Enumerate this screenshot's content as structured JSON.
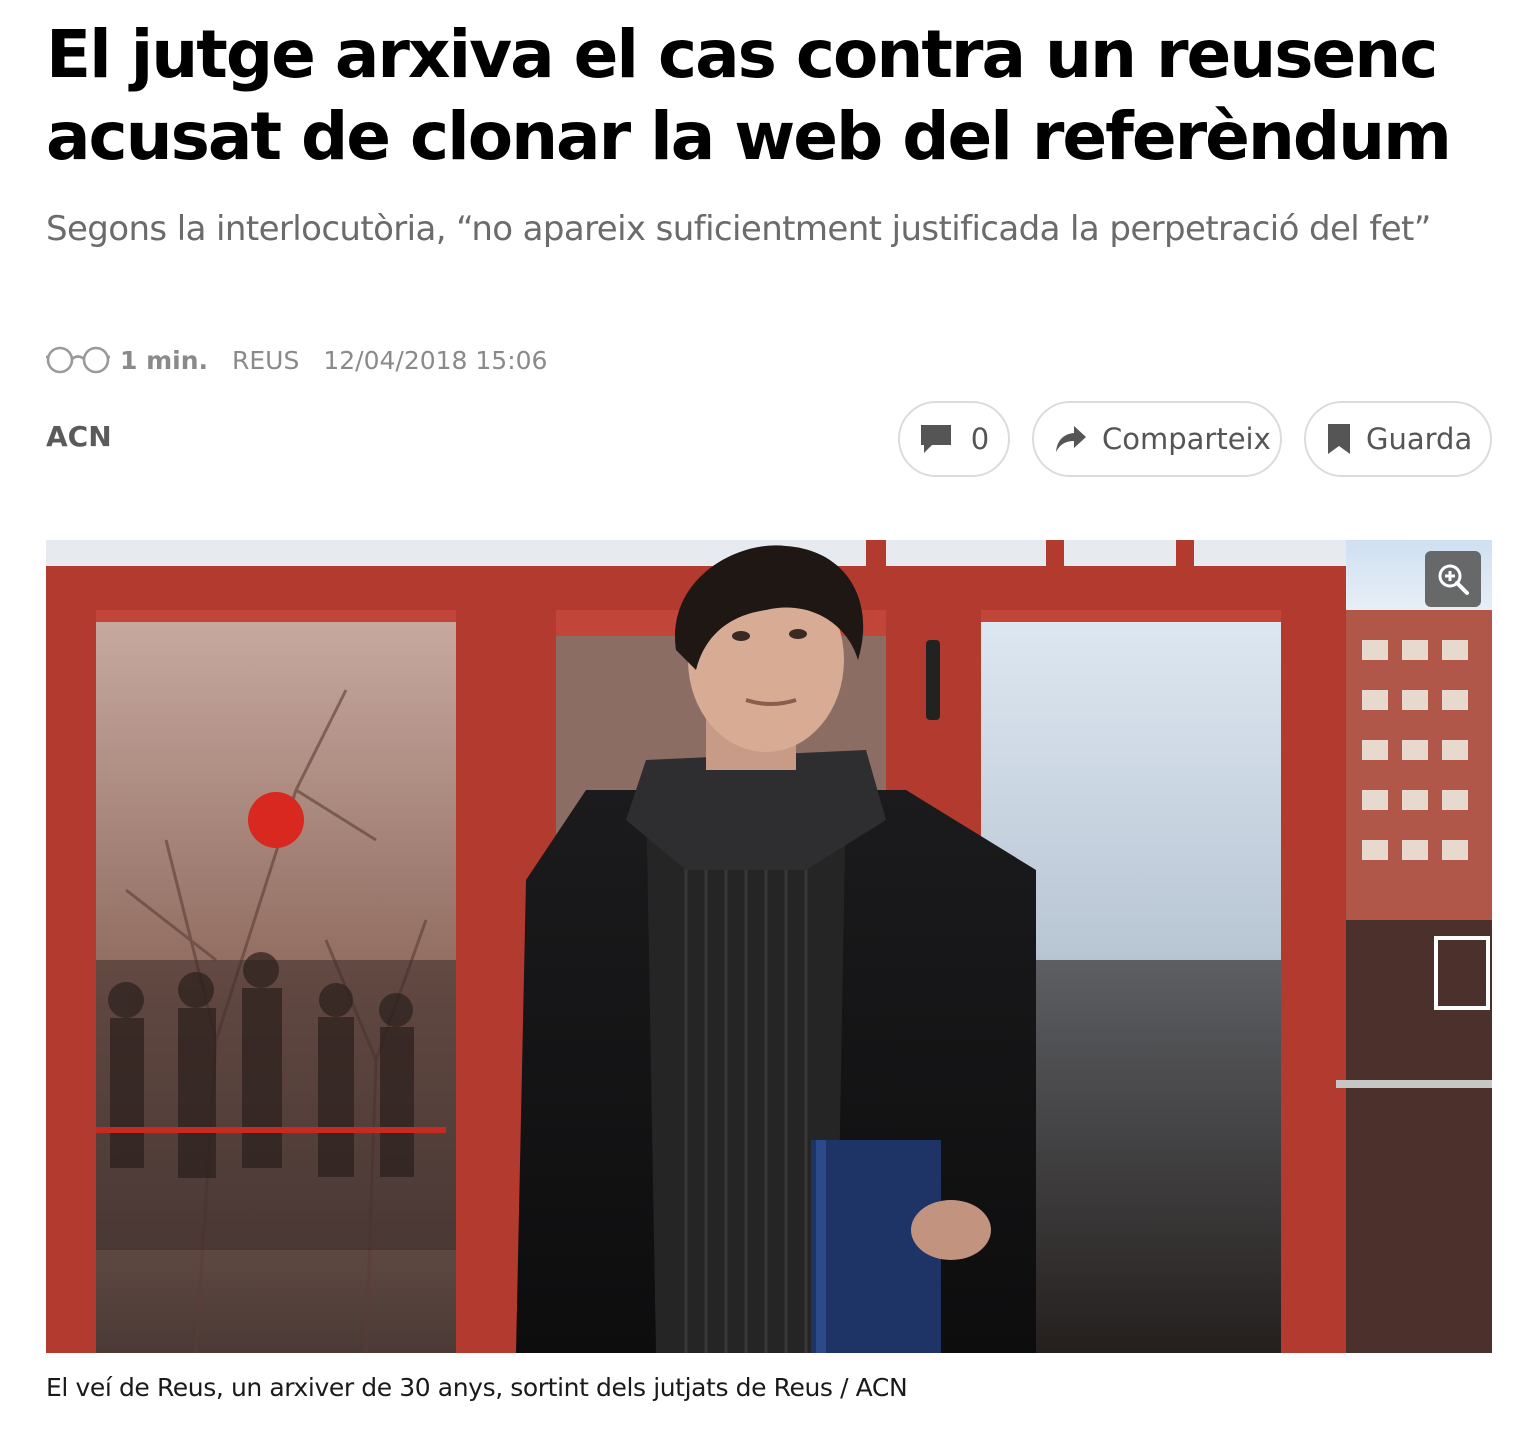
{
  "article": {
    "headline": "El jutge arxiva el cas contra un reusenc acusat de clonar la web del referèndum",
    "subtitle": "Segons la interlocutòria, “no apareix suficientment justificada la perpetració del fet”",
    "meta": {
      "read_time": "1 min.",
      "location": "REUS",
      "date": "12/04/2018 15:06",
      "icon": "glasses-icon"
    },
    "byline": "ACN",
    "actions": {
      "comments_count": "0",
      "share_label": "Comparteix",
      "save_label": "Guarda"
    },
    "image": {
      "caption": "El veí de Reus, un arxiver de 30 anys, sortint dels jutjats de Reus / ACN",
      "zoom_icon": "zoom-in-icon"
    }
  },
  "colors": {
    "headline": "#000000",
    "subtitle": "#6b6b6b",
    "meta": "#8a8a8a",
    "byline": "#5a5a5a",
    "pill_border": "#dcdcdc",
    "door_frame": "#b23a2e"
  }
}
